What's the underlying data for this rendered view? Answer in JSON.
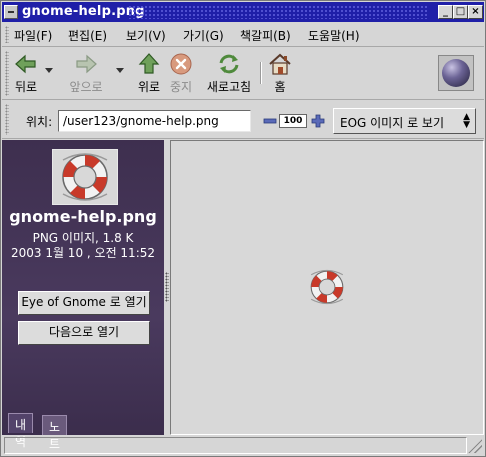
{
  "window": {
    "title": "gnome-help.png"
  },
  "menu": [
    "파일(F)",
    "편집(E)",
    "보기(V)",
    "가기(G)",
    "책갈피(B)",
    "도움말(H)"
  ],
  "toolbar": {
    "back": "뒤로",
    "forward": "앞으로",
    "up": "위로",
    "stop": "중지",
    "reload": "새로고침",
    "home": "홈"
  },
  "location": {
    "label": "위치:",
    "value": "/user123/gnome-help.png",
    "zoom": "100",
    "viewer": "EOG 이미지 로 보기"
  },
  "sidebar": {
    "filename": "gnome-help.png",
    "filetype": "PNG 이미지, 1.8 K",
    "date": "2003  1월 10 , 오전 11:52",
    "open_eog": "Eye of Gnome 로 열기",
    "open_with": "다음으로 열기",
    "tabs": [
      "내역",
      "노트"
    ]
  },
  "colors": {
    "titlebar": "#1f1fa8",
    "sidebar": "#4a3a5e"
  },
  "icons": [
    "back-arrow-icon",
    "forward-arrow-icon",
    "up-arrow-icon",
    "stop-icon",
    "reload-icon",
    "home-icon",
    "lifebuoy-icon",
    "throbber-icon"
  ]
}
